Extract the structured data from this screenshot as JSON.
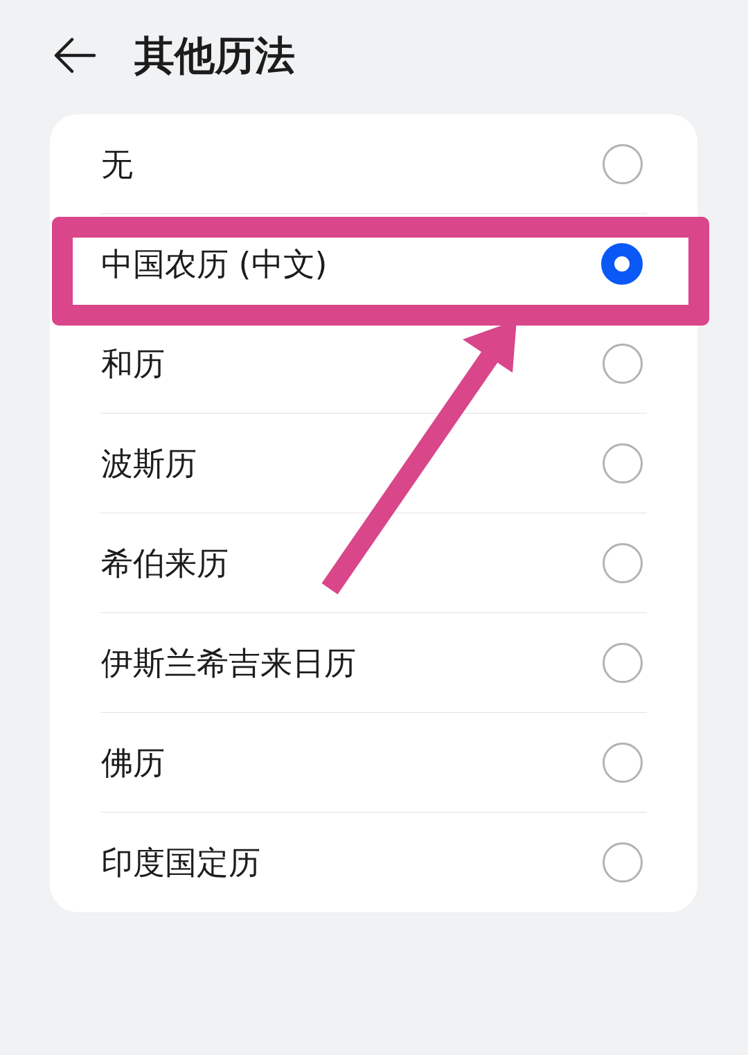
{
  "header": {
    "title": "其他历法"
  },
  "options": [
    {
      "label": "无",
      "selected": false
    },
    {
      "label": "中国农历 (中文)",
      "selected": true
    },
    {
      "label": "和历",
      "selected": false
    },
    {
      "label": "波斯历",
      "selected": false
    },
    {
      "label": "希伯来历",
      "selected": false
    },
    {
      "label": "伊斯兰希吉来日历",
      "selected": false
    },
    {
      "label": "佛历",
      "selected": false
    },
    {
      "label": "印度国定历",
      "selected": false
    }
  ]
}
